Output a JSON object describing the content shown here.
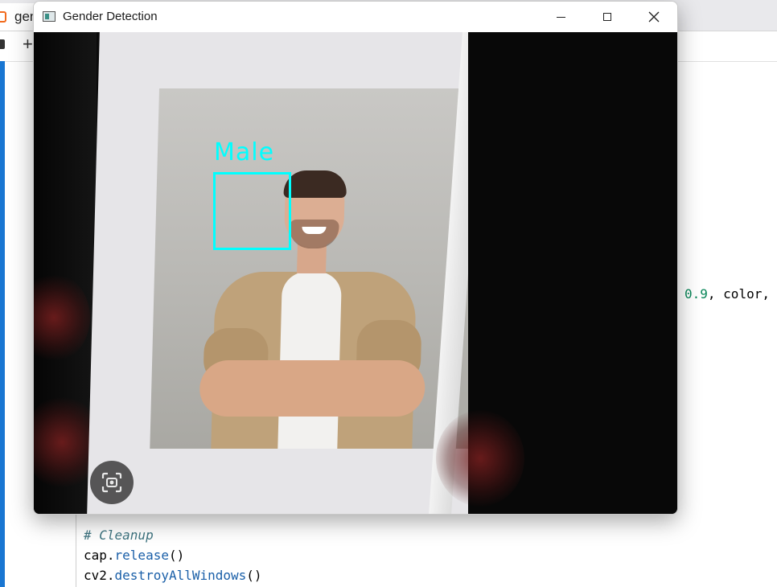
{
  "background_editor": {
    "tab_label": "gen",
    "add_symbol": "+",
    "code_line_a": {
      "num": "0.9",
      "rest": ", color,"
    },
    "code_comment": "# Cleanup",
    "code_release": {
      "obj": "cap.",
      "fn": "release",
      "tail": "()"
    },
    "code_destroy": {
      "obj": "cv2.",
      "fn": "destroyAllWindows",
      "tail": "()"
    }
  },
  "window": {
    "title": "Gender Detection",
    "detection_label": "Male",
    "detection_color": "#00ffff"
  },
  "icons": {
    "app": "app-window-icon",
    "minimize": "minimize-icon",
    "maximize": "maximize-icon",
    "close": "close-icon",
    "screenshot": "screenshot-icon"
  },
  "colors": {
    "accent_cell_bar": "#1976d2",
    "code_number": "#098658",
    "code_function": "#1a5fa8",
    "code_comment": "#3e7480"
  }
}
